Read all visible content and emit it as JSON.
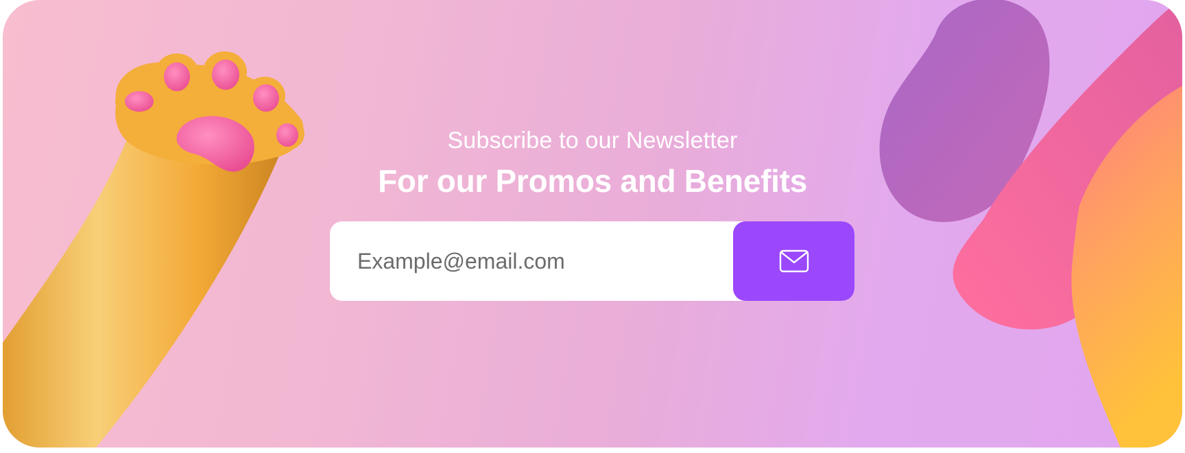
{
  "newsletter": {
    "subtitle": "Subscribe to our Newsletter",
    "headline": "For our Promos and Benefits",
    "email_placeholder": "Example@email.com",
    "submit_icon": "mail-icon"
  },
  "colors": {
    "accent": "#9b47fc",
    "text": "#ffffff",
    "paw": "#f5b13c",
    "paw_pad": "#f46ba8",
    "blob_purple": "#a965c4",
    "blob_pink": "#ff6fa0",
    "blob_orange": "#ffb347"
  },
  "decorations": {
    "left_image": "cat-paw-illustration",
    "right_image": "abstract-blob-shapes"
  }
}
